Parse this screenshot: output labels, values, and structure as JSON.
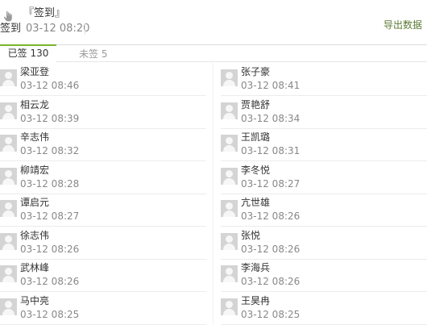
{
  "header": {
    "title": "『签到』",
    "label": "签到",
    "time": "03-12 08:20",
    "export_label": "导出数据"
  },
  "tabs": {
    "signed": "已签 130",
    "unsigned": "未签 5"
  },
  "rows": [
    [
      {
        "name": "梁亚登",
        "time": "03-12 08:46"
      },
      {
        "name": "张子豪",
        "time": "03-12 08:41"
      }
    ],
    [
      {
        "name": "相云龙",
        "time": "03-12 08:39"
      },
      {
        "name": "贾艳舒",
        "time": "03-12 08:34"
      }
    ],
    [
      {
        "name": "辛志伟",
        "time": "03-12 08:32"
      },
      {
        "name": "王凯璐",
        "time": "03-12 08:31"
      }
    ],
    [
      {
        "name": "柳靖宏",
        "time": "03-12 08:28"
      },
      {
        "name": "李冬悦",
        "time": "03-12 08:27"
      }
    ],
    [
      {
        "name": "谭启元",
        "time": "03-12 08:27"
      },
      {
        "name": "亢世雄",
        "time": "03-12 08:26"
      }
    ],
    [
      {
        "name": "徐志伟",
        "time": "03-12 08:26"
      },
      {
        "name": "张悦",
        "time": "03-12 08:26"
      }
    ],
    [
      {
        "name": "武林峰",
        "time": "03-12 08:26"
      },
      {
        "name": "李海兵",
        "time": "03-12 08:26"
      }
    ],
    [
      {
        "name": "马中亮",
        "time": "03-12 08:25"
      },
      {
        "name": "王昊冉",
        "time": "03-12 08:25"
      }
    ]
  ],
  "colors": {
    "accent": "#7bb52c",
    "export_text": "#5c7a35"
  }
}
